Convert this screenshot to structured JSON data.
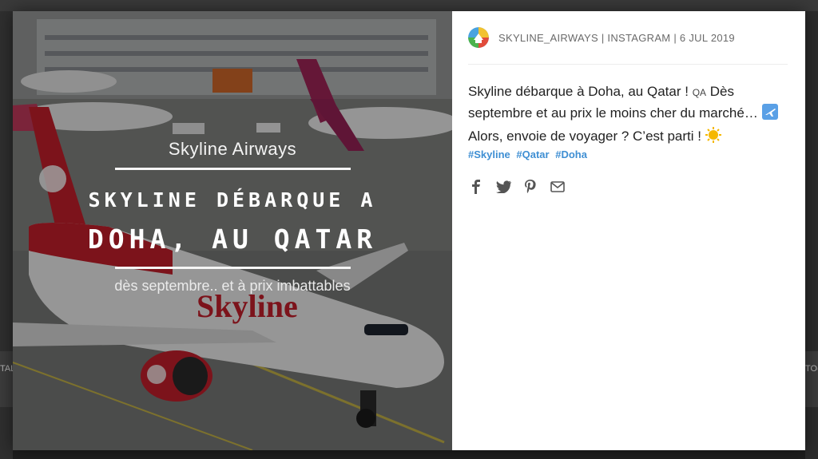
{
  "background": {
    "left_fragment": "TALIT",
    "right_fragment": "TO(S"
  },
  "photo": {
    "brand_line": "Skyline Airways",
    "headline_1": "SKYLINE DÉBARQUE A",
    "headline_2": "DOHA, AU QATAR",
    "subline": "dès septembre.. et à prix imbattables",
    "aircraft_text": "Skyline"
  },
  "post": {
    "meta": "SKYLINE_AIRWAYS | INSTAGRAM | 6 JUL 2019",
    "caption_1": "Skyline débarque à Doha, au Qatar !",
    "caption_badge": "QA",
    "caption_2": "Dès septembre et au prix le moins cher du marché…",
    "caption_3": "Alors, envoie de voyager ? C’est parti !",
    "hashtags": [
      "#Skyline",
      "#Qatar",
      "#Doha"
    ],
    "share_icons": [
      "facebook-icon",
      "twitter-icon",
      "pinterest-icon",
      "email-icon"
    ]
  },
  "colors": {
    "hashtag": "#3f8fd3",
    "airline_red": "#c8202c"
  }
}
